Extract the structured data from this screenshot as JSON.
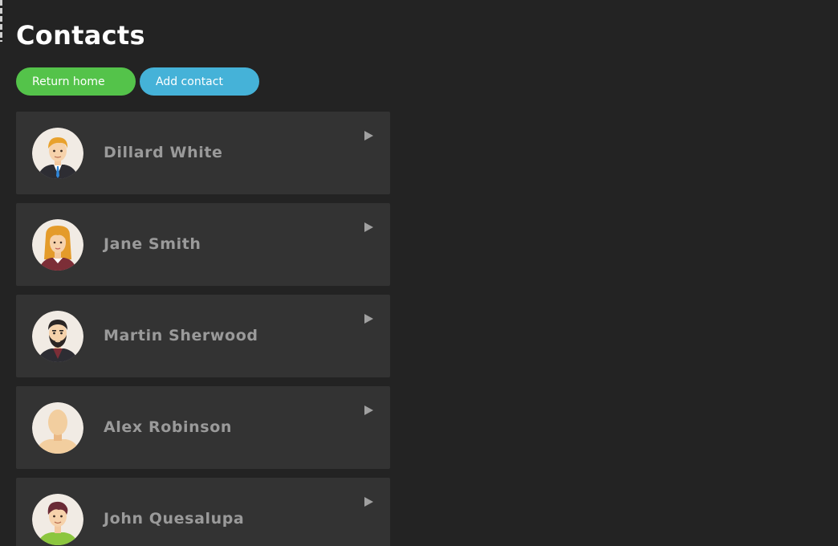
{
  "page": {
    "title": "Contacts"
  },
  "actions": {
    "return_home_label": "Return home",
    "add_contact_label": "Add contact",
    "return_home_color": "#54c34a",
    "add_contact_color": "#45b2d8"
  },
  "contacts": [
    {
      "name": "Dillard White",
      "avatar": "man-suit-blue-tie-avatar"
    },
    {
      "name": "Jane Smith",
      "avatar": "woman-orange-hair-avatar"
    },
    {
      "name": "Martin Sherwood",
      "avatar": "man-beard-avatar"
    },
    {
      "name": "Alex Robinson",
      "avatar": "blank-default-avatar"
    },
    {
      "name": "John Quesalupa",
      "avatar": "young-man-green-shirt-avatar"
    }
  ],
  "icons": {
    "expand": "triangle-right-icon"
  }
}
